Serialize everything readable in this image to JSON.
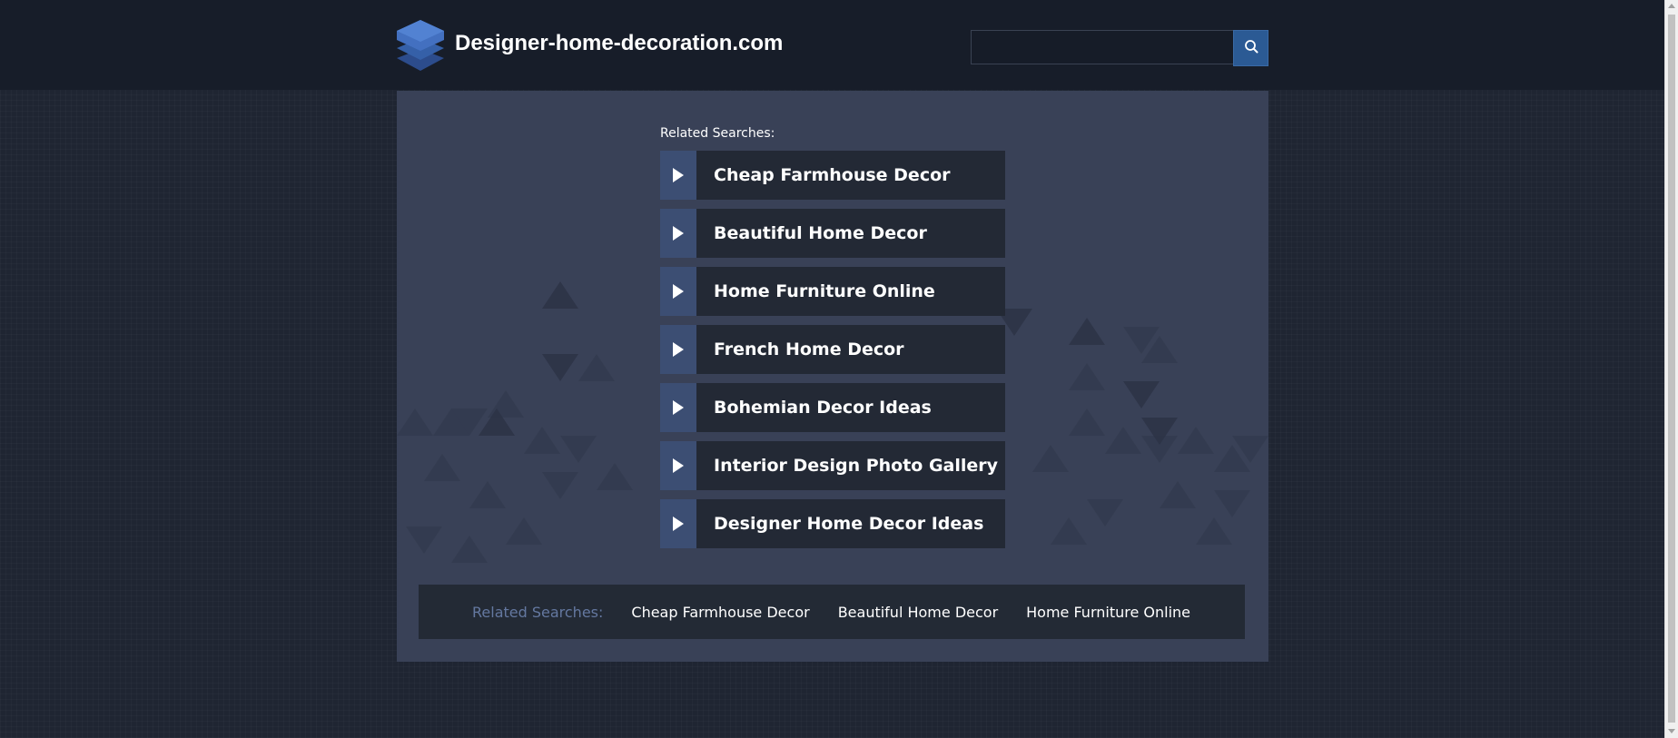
{
  "header": {
    "site_title": "Designer-home-decoration.com",
    "logo_icon": "stacked-layers-icon",
    "search": {
      "value": "",
      "placeholder": "",
      "button_icon": "search-icon"
    }
  },
  "main": {
    "related_heading": "Related Searches:",
    "links": [
      {
        "label": "Cheap Farmhouse Decor",
        "icon": "play-arrow-icon"
      },
      {
        "label": "Beautiful Home Decor",
        "icon": "play-arrow-icon"
      },
      {
        "label": "Home Furniture Online",
        "icon": "play-arrow-icon"
      },
      {
        "label": "French Home Decor",
        "icon": "play-arrow-icon"
      },
      {
        "label": "Bohemian Decor Ideas",
        "icon": "play-arrow-icon"
      },
      {
        "label": "Interior Design Photo Gallery",
        "icon": "play-arrow-icon"
      },
      {
        "label": "Designer Home Decor Ideas",
        "icon": "play-arrow-icon"
      }
    ]
  },
  "footer": {
    "label": "Related Searches:",
    "links": [
      "Cheap Farmhouse Decor",
      "Beautiful Home Decor",
      "Home Furniture Online"
    ]
  },
  "colors": {
    "page_background": "#1f2532",
    "header_background": "#171d29",
    "panel_background": "#394157",
    "link_background": "#232935",
    "arrow_background": "#3c4e73",
    "search_button": "#2b5a94",
    "footer_label": "#6478a0"
  }
}
